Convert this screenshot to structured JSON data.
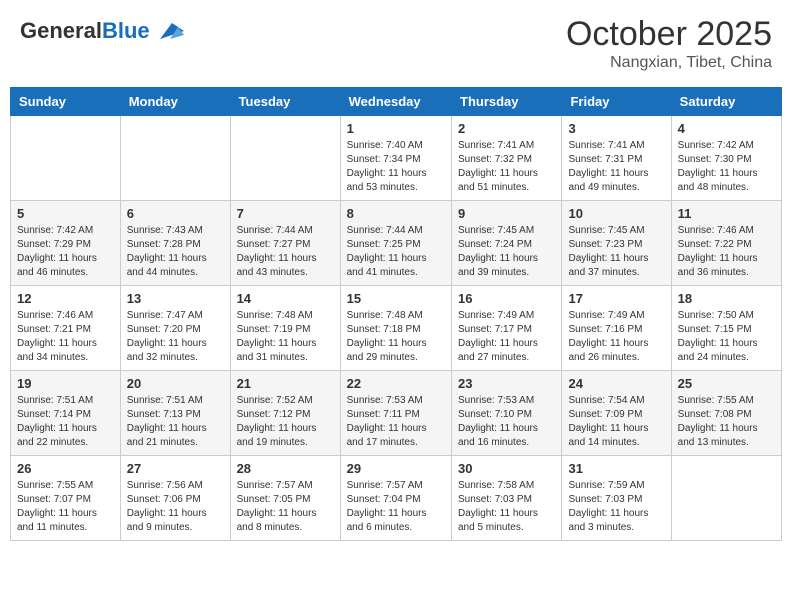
{
  "header": {
    "logo_general": "General",
    "logo_blue": "Blue",
    "month": "October 2025",
    "location": "Nangxian, Tibet, China"
  },
  "weekdays": [
    "Sunday",
    "Monday",
    "Tuesday",
    "Wednesday",
    "Thursday",
    "Friday",
    "Saturday"
  ],
  "weeks": [
    [
      {
        "day": "",
        "info": ""
      },
      {
        "day": "",
        "info": ""
      },
      {
        "day": "",
        "info": ""
      },
      {
        "day": "1",
        "info": "Sunrise: 7:40 AM\nSunset: 7:34 PM\nDaylight: 11 hours\nand 53 minutes."
      },
      {
        "day": "2",
        "info": "Sunrise: 7:41 AM\nSunset: 7:32 PM\nDaylight: 11 hours\nand 51 minutes."
      },
      {
        "day": "3",
        "info": "Sunrise: 7:41 AM\nSunset: 7:31 PM\nDaylight: 11 hours\nand 49 minutes."
      },
      {
        "day": "4",
        "info": "Sunrise: 7:42 AM\nSunset: 7:30 PM\nDaylight: 11 hours\nand 48 minutes."
      }
    ],
    [
      {
        "day": "5",
        "info": "Sunrise: 7:42 AM\nSunset: 7:29 PM\nDaylight: 11 hours\nand 46 minutes."
      },
      {
        "day": "6",
        "info": "Sunrise: 7:43 AM\nSunset: 7:28 PM\nDaylight: 11 hours\nand 44 minutes."
      },
      {
        "day": "7",
        "info": "Sunrise: 7:44 AM\nSunset: 7:27 PM\nDaylight: 11 hours\nand 43 minutes."
      },
      {
        "day": "8",
        "info": "Sunrise: 7:44 AM\nSunset: 7:25 PM\nDaylight: 11 hours\nand 41 minutes."
      },
      {
        "day": "9",
        "info": "Sunrise: 7:45 AM\nSunset: 7:24 PM\nDaylight: 11 hours\nand 39 minutes."
      },
      {
        "day": "10",
        "info": "Sunrise: 7:45 AM\nSunset: 7:23 PM\nDaylight: 11 hours\nand 37 minutes."
      },
      {
        "day": "11",
        "info": "Sunrise: 7:46 AM\nSunset: 7:22 PM\nDaylight: 11 hours\nand 36 minutes."
      }
    ],
    [
      {
        "day": "12",
        "info": "Sunrise: 7:46 AM\nSunset: 7:21 PM\nDaylight: 11 hours\nand 34 minutes."
      },
      {
        "day": "13",
        "info": "Sunrise: 7:47 AM\nSunset: 7:20 PM\nDaylight: 11 hours\nand 32 minutes."
      },
      {
        "day": "14",
        "info": "Sunrise: 7:48 AM\nSunset: 7:19 PM\nDaylight: 11 hours\nand 31 minutes."
      },
      {
        "day": "15",
        "info": "Sunrise: 7:48 AM\nSunset: 7:18 PM\nDaylight: 11 hours\nand 29 minutes."
      },
      {
        "day": "16",
        "info": "Sunrise: 7:49 AM\nSunset: 7:17 PM\nDaylight: 11 hours\nand 27 minutes."
      },
      {
        "day": "17",
        "info": "Sunrise: 7:49 AM\nSunset: 7:16 PM\nDaylight: 11 hours\nand 26 minutes."
      },
      {
        "day": "18",
        "info": "Sunrise: 7:50 AM\nSunset: 7:15 PM\nDaylight: 11 hours\nand 24 minutes."
      }
    ],
    [
      {
        "day": "19",
        "info": "Sunrise: 7:51 AM\nSunset: 7:14 PM\nDaylight: 11 hours\nand 22 minutes."
      },
      {
        "day": "20",
        "info": "Sunrise: 7:51 AM\nSunset: 7:13 PM\nDaylight: 11 hours\nand 21 minutes."
      },
      {
        "day": "21",
        "info": "Sunrise: 7:52 AM\nSunset: 7:12 PM\nDaylight: 11 hours\nand 19 minutes."
      },
      {
        "day": "22",
        "info": "Sunrise: 7:53 AM\nSunset: 7:11 PM\nDaylight: 11 hours\nand 17 minutes."
      },
      {
        "day": "23",
        "info": "Sunrise: 7:53 AM\nSunset: 7:10 PM\nDaylight: 11 hours\nand 16 minutes."
      },
      {
        "day": "24",
        "info": "Sunrise: 7:54 AM\nSunset: 7:09 PM\nDaylight: 11 hours\nand 14 minutes."
      },
      {
        "day": "25",
        "info": "Sunrise: 7:55 AM\nSunset: 7:08 PM\nDaylight: 11 hours\nand 13 minutes."
      }
    ],
    [
      {
        "day": "26",
        "info": "Sunrise: 7:55 AM\nSunset: 7:07 PM\nDaylight: 11 hours\nand 11 minutes."
      },
      {
        "day": "27",
        "info": "Sunrise: 7:56 AM\nSunset: 7:06 PM\nDaylight: 11 hours\nand 9 minutes."
      },
      {
        "day": "28",
        "info": "Sunrise: 7:57 AM\nSunset: 7:05 PM\nDaylight: 11 hours\nand 8 minutes."
      },
      {
        "day": "29",
        "info": "Sunrise: 7:57 AM\nSunset: 7:04 PM\nDaylight: 11 hours\nand 6 minutes."
      },
      {
        "day": "30",
        "info": "Sunrise: 7:58 AM\nSunset: 7:03 PM\nDaylight: 11 hours\nand 5 minutes."
      },
      {
        "day": "31",
        "info": "Sunrise: 7:59 AM\nSunset: 7:03 PM\nDaylight: 11 hours\nand 3 minutes."
      },
      {
        "day": "",
        "info": ""
      }
    ]
  ]
}
